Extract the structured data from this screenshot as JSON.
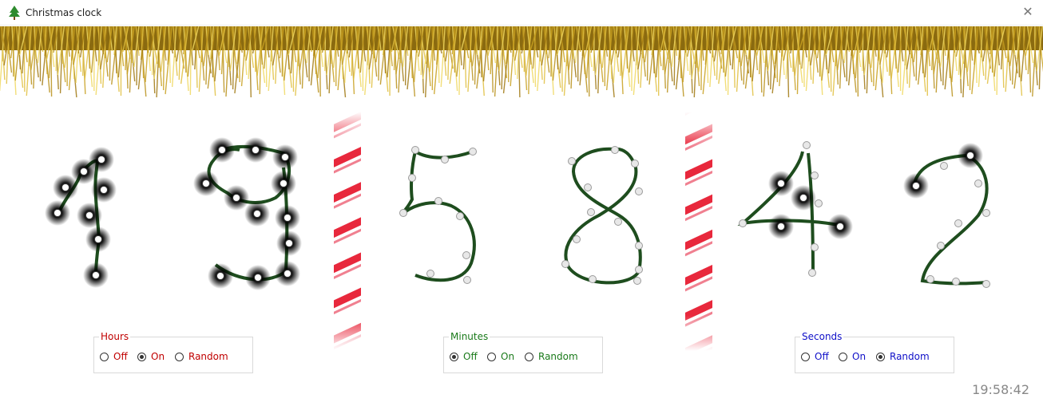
{
  "window": {
    "title": "Christmas clock",
    "close_glyph": "✕"
  },
  "time": {
    "hours": "19",
    "minutes": "58",
    "seconds": "42",
    "display": "19:58:42"
  },
  "groups": {
    "hours": {
      "legend": "Hours",
      "color": "#c00000",
      "options": [
        "Off",
        "On",
        "Random"
      ],
      "selected": "On"
    },
    "minutes": {
      "legend": "Minutes",
      "color": "#1a7a1a",
      "options": [
        "Off",
        "On",
        "Random"
      ],
      "selected": "Off"
    },
    "seconds": {
      "legend": "Seconds",
      "color": "#1010c8",
      "options": [
        "Off",
        "On",
        "Random"
      ],
      "selected": "Random"
    }
  },
  "colors": {
    "tinsel": "#c8a020",
    "wire": "#1e4d1e",
    "candy_stripe": "#e8283c"
  },
  "icons": {
    "app": "christmas-tree-icon",
    "close": "close-icon"
  }
}
